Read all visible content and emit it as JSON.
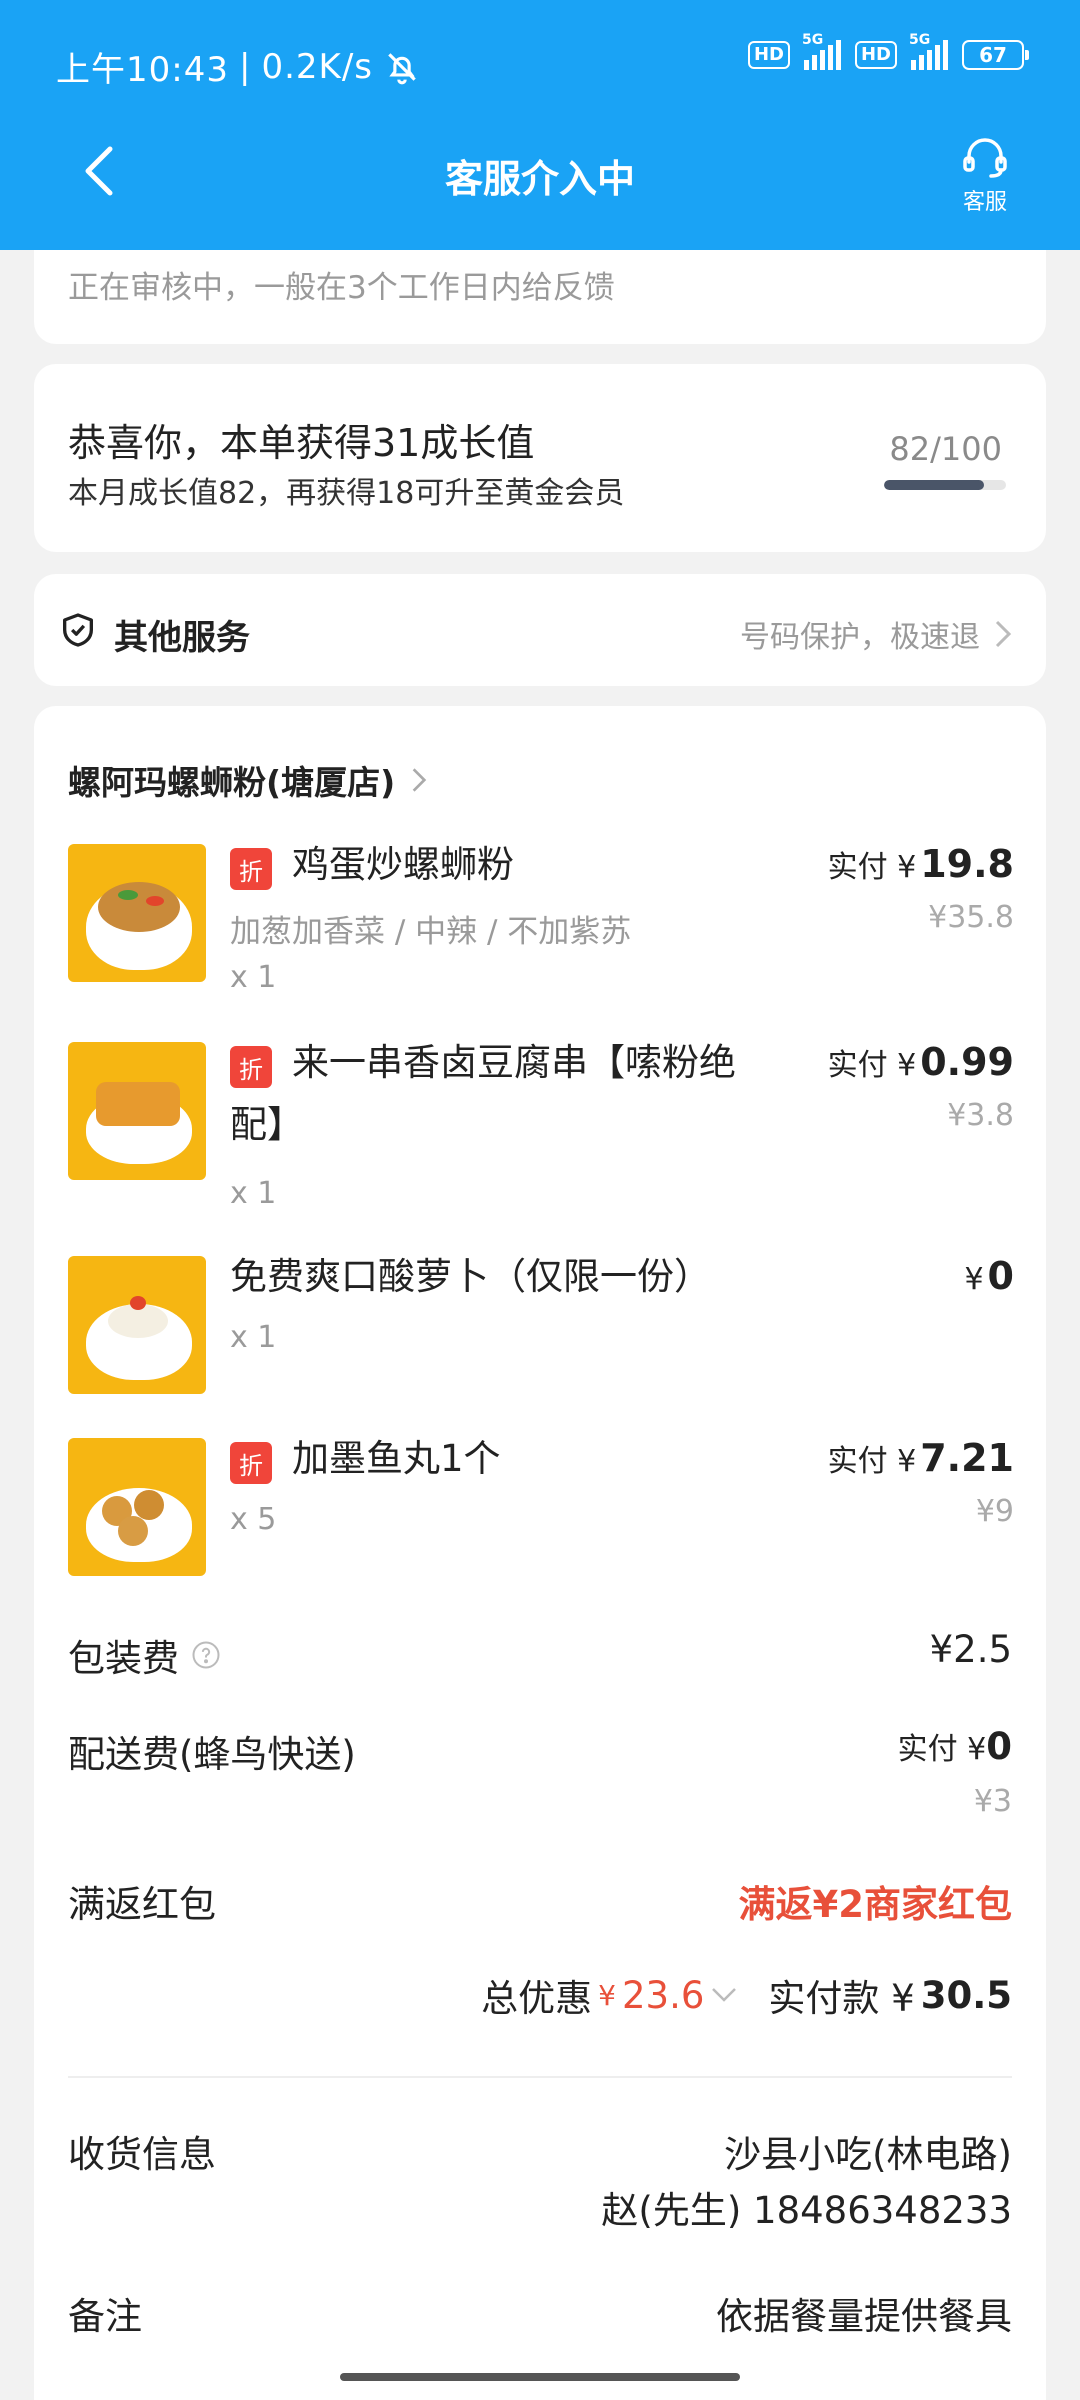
{
  "status_bar": {
    "time": "上午10:43",
    "speed": "0.2K/s",
    "hd": "HD",
    "net": "5G",
    "battery": "67"
  },
  "nav": {
    "title": "客服介入中",
    "cs_label": "客服"
  },
  "review": {
    "text": "正在审核中，一般在3个工作日内给反馈"
  },
  "growth": {
    "title": "恭喜你，本单获得31成长值",
    "subtitle": "本月成长值82，再获得18可升至黄金会员",
    "count": "82/100",
    "progress": 0.82
  },
  "services": {
    "title": "其他服务",
    "detail": "号码保护，极速退"
  },
  "order": {
    "store": "螺阿玛螺蛳粉(塘厦店)",
    "items": [
      {
        "tag": "折",
        "name": "鸡蛋炒螺蛳粉",
        "spec": "加葱加香菜 / 中辣 / 不加紫苏",
        "qty": "x 1",
        "paid_label": "实付 ¥",
        "price": "19.8",
        "orig": "¥35.8"
      },
      {
        "tag": "折",
        "name_line1": "来一串香卤豆腐串【嗦粉绝",
        "name_line2": "配】",
        "qty": "x 1",
        "paid_label": "实付 ¥",
        "price": "0.99",
        "orig": "¥3.8"
      },
      {
        "name": "免费爽口酸萝卜（仅限一份）",
        "qty": "x 1",
        "paid_label": "¥",
        "price": "0"
      },
      {
        "tag": "折",
        "name": "加墨鱼丸1个",
        "qty": "x 5",
        "paid_label": "实付 ¥",
        "price": "7.21",
        "orig": "¥9"
      }
    ],
    "packing": {
      "label": "包装费",
      "value": "¥2.5"
    },
    "delivery": {
      "label": "配送费(蜂鸟快送)",
      "paid_label": "实付 ¥",
      "value": "0",
      "orig": "¥3"
    },
    "coupon": {
      "label": "满返红包",
      "value": "满返¥2商家红包"
    },
    "summary": {
      "discount_label": "总优惠",
      "discount_currency": "¥",
      "discount": "23.6",
      "paid_label": "实付款 ¥",
      "paid": "30.5"
    },
    "receive": {
      "label": "收货信息",
      "address": "沙县小吃(林电路)",
      "contact": "赵(先生) 18486348233"
    },
    "note": {
      "label": "备注",
      "value": "依据餐量提供餐具"
    }
  },
  "colors": {
    "header": "#1aa3f5",
    "accent_red": "#e8503a",
    "tag_red": "#f0453a"
  }
}
